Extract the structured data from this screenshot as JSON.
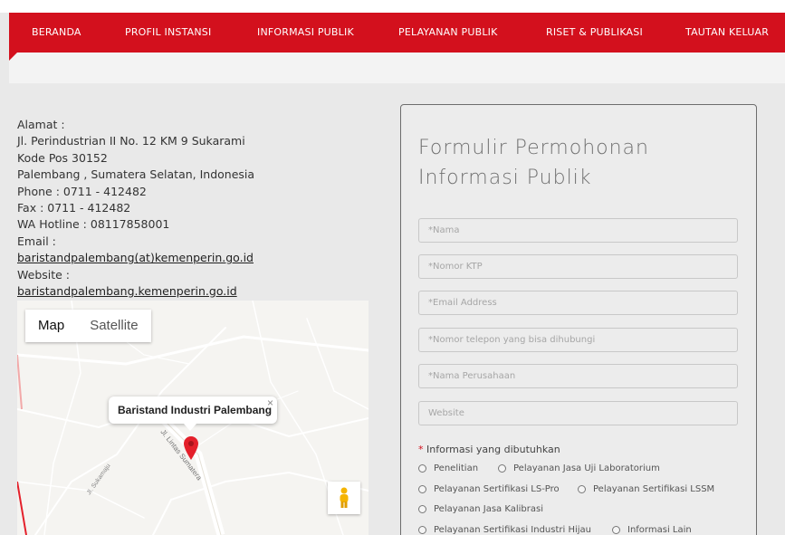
{
  "nav": {
    "items": [
      "BERANDA",
      "PROFIL INSTANSI",
      "INFORMASI PUBLIK",
      "PELAYANAN PUBLIK",
      "RISET & PUBLIKASI",
      "TAUTAN KELUAR"
    ]
  },
  "contact": {
    "lines": [
      "Alamat :",
      "Jl. Perindustrian II No. 12 KM 9 Sukarami",
      "Kode Pos 30152",
      "Palembang , Sumatera Selatan, Indonesia",
      "Phone : 0711 - 412482",
      "Fax : 0711 - 412482",
      "WA Hotline : 08117858001",
      "Email :"
    ],
    "email": "baristandpalembang(at)kemenperin.go.id",
    "website_label": "Website :",
    "website": "baristandpalembang.kemenperin.go.id"
  },
  "map": {
    "toggle_map": "Map",
    "toggle_satellite": "Satellite",
    "info_title": "Baristand Industri Palembang",
    "close": "×",
    "road_label_1": "Jl. Lintas Sumatera",
    "road_label_2": "Jl. Sukamaju"
  },
  "form": {
    "title": "Formulir Permohonan Informasi Publik",
    "fields": [
      "*Nama",
      "*Nomor KTP",
      "*Email Address",
      "*Nomor telepon yang bisa dihubungi",
      "*Nama Perusahaan",
      "Website"
    ],
    "info_label_star": "*",
    "info_label": "Informasi yang dibutuhkan",
    "options": [
      "Penelitian",
      "Pelayanan Jasa Uji Laboratorium",
      "Pelayanan Sertifikasi LS-Pro",
      "Pelayanan Sertifikasi LSSM",
      "Pelayanan Jasa Kalibrasi",
      "Pelayanan Sertifikasi Industri Hijau",
      "Informasi Lain"
    ]
  },
  "colors": {
    "nav_bg": "#d3101d",
    "map_marker": "#e4202b"
  }
}
